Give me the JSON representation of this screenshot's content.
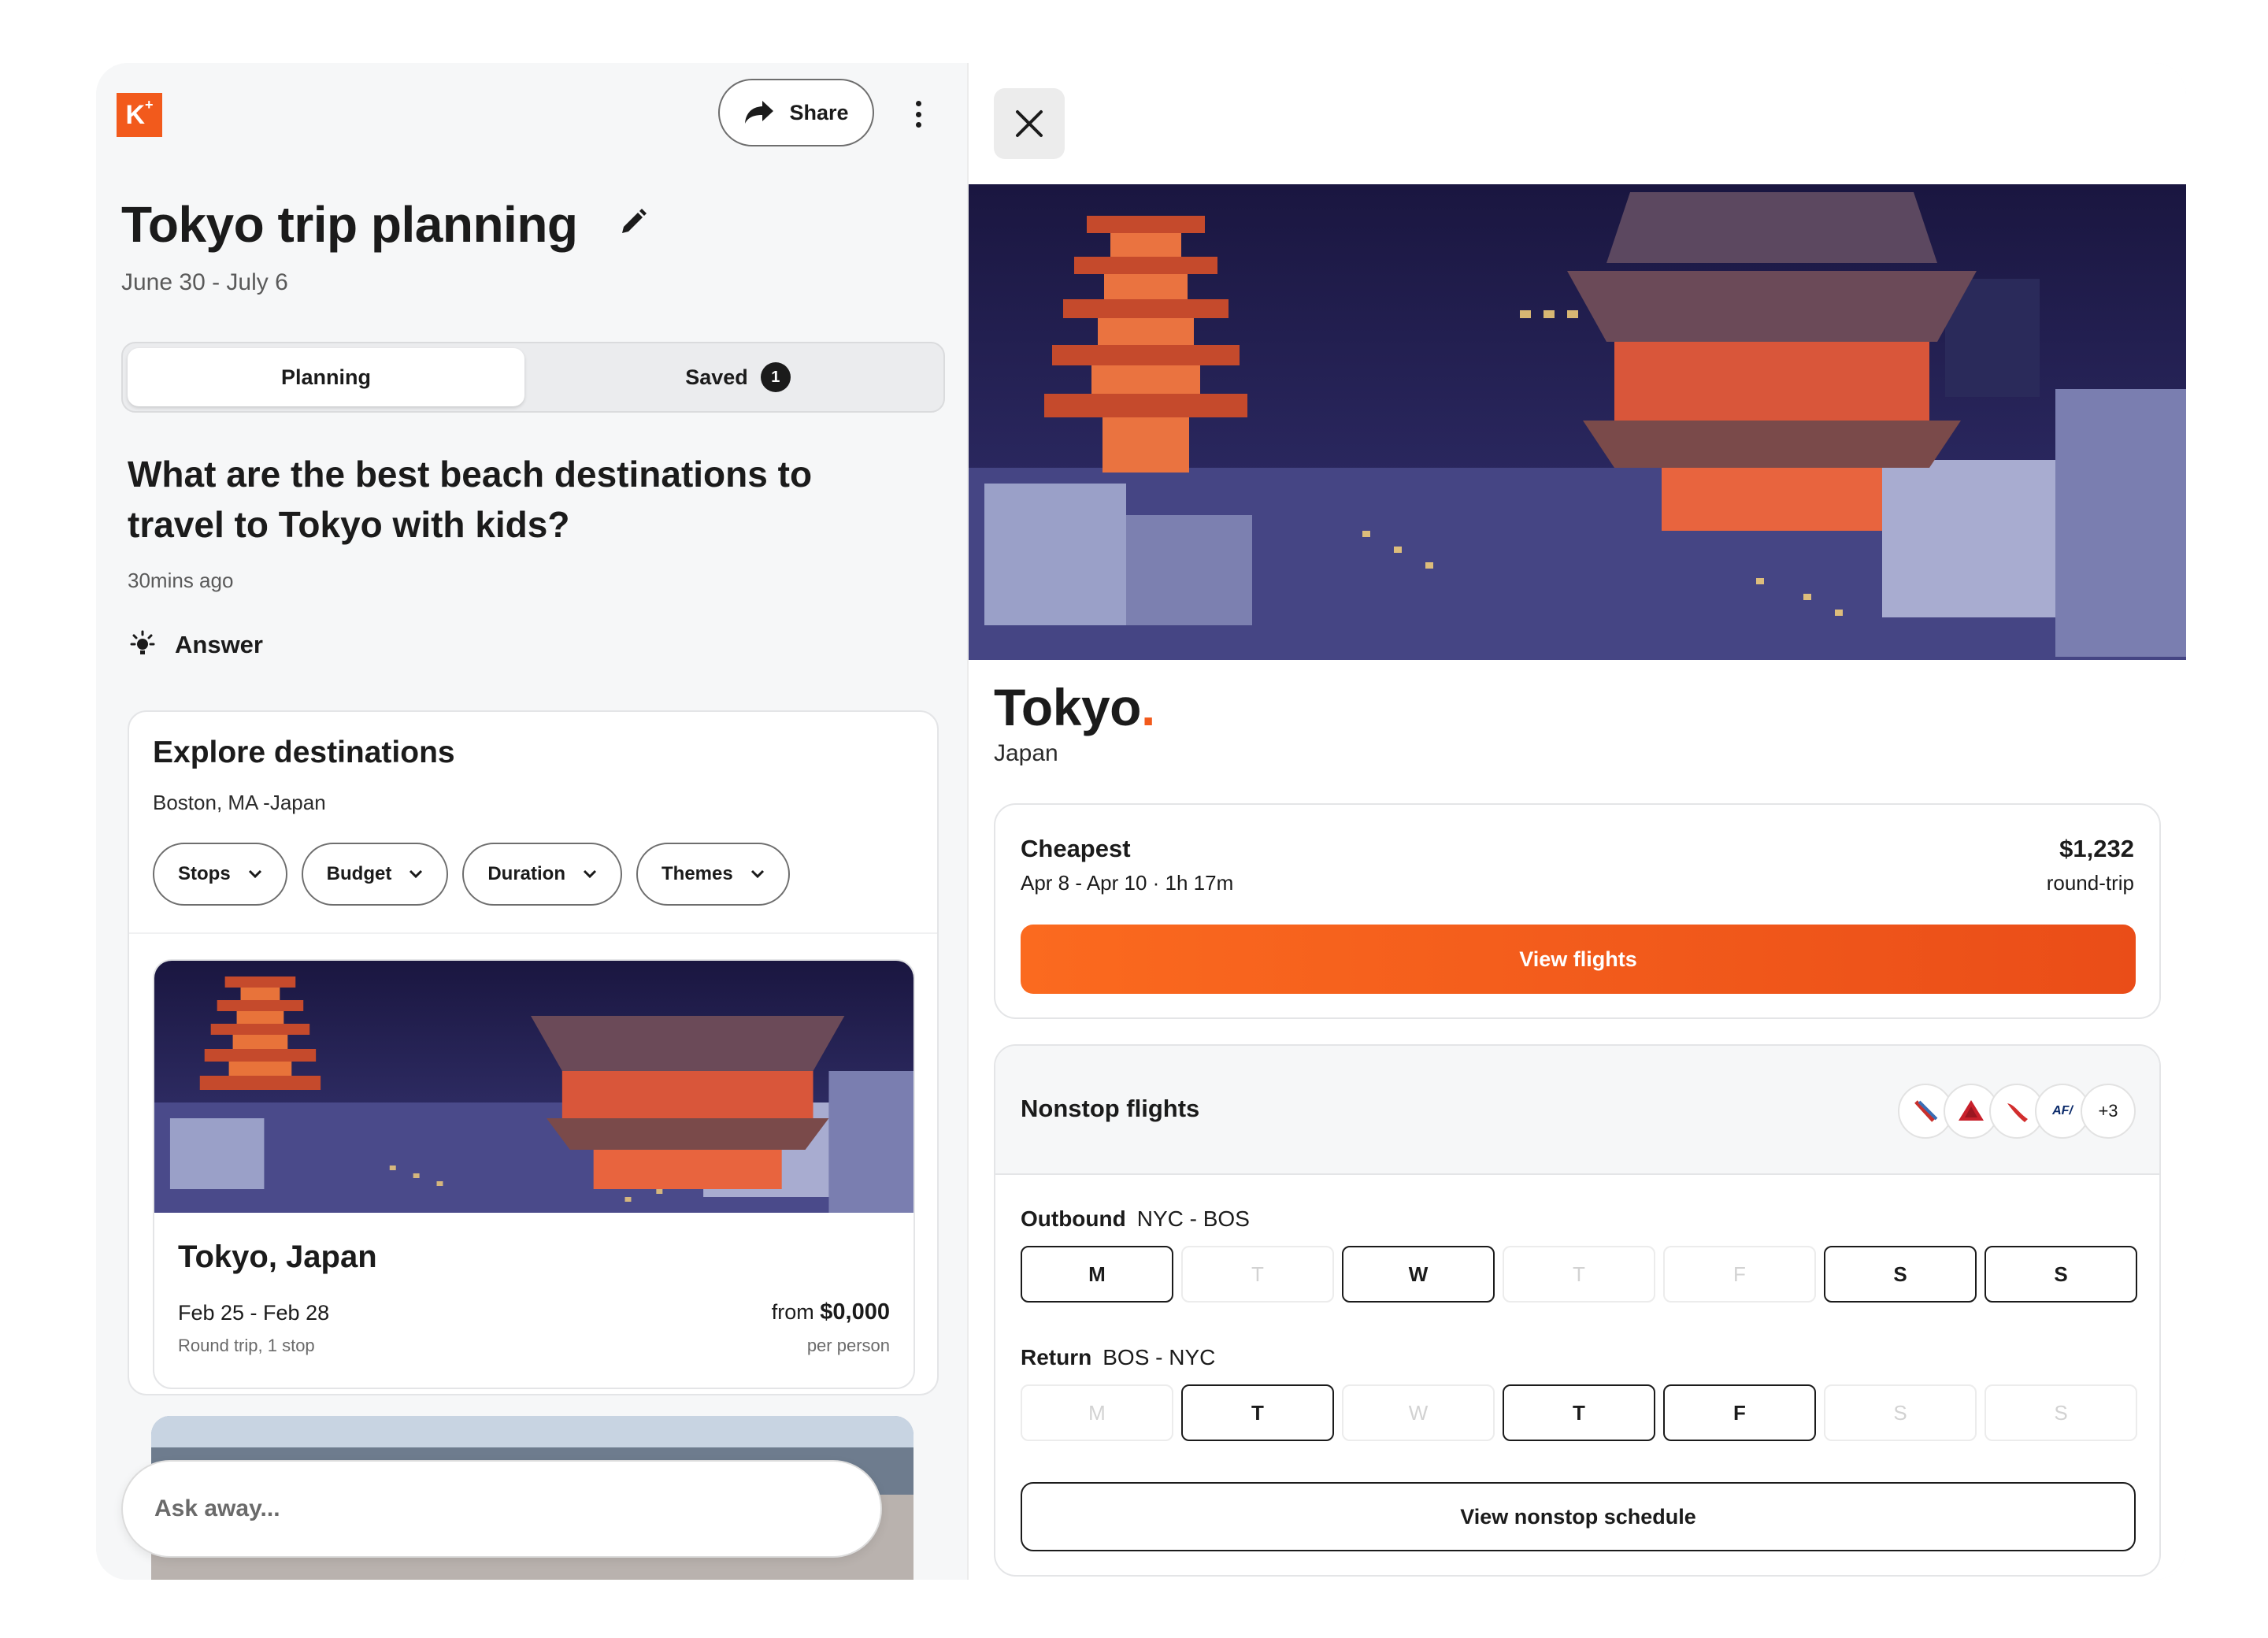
{
  "app": {
    "logo_text": "K",
    "logo_mark": "+"
  },
  "header": {
    "share_label": "Share"
  },
  "trip": {
    "title": "Tokyo trip planning",
    "dates": "June 30 - July 6"
  },
  "tabs": [
    {
      "label": "Planning",
      "active": true
    },
    {
      "label": "Saved",
      "badge": "1",
      "active": false
    }
  ],
  "conversation": {
    "question": "What are the best beach destinations to travel to Tokyo with kids?",
    "time": "30mins ago",
    "answer_label": "Answer"
  },
  "explore": {
    "title": "Explore destinations",
    "route": "Boston, MA -Japan",
    "filters": [
      "Stops",
      "Budget",
      "Duration",
      "Themes"
    ],
    "results": [
      {
        "name": "Tokyo, Japan",
        "dates": "Feb 25 - Feb 28",
        "trip": "Round trip, 1 stop",
        "price_prefix": "from",
        "price": "$0,000",
        "price_note": "per person"
      }
    ]
  },
  "composer": {
    "placeholder": "Ask away..."
  },
  "detail": {
    "city": "Tokyo",
    "city_dot": ".",
    "country": "Japan",
    "cheapest": {
      "label": "Cheapest",
      "dates": "Apr 8 - Apr 10 · 1h 17m",
      "price": "$1,232",
      "trip_type": "round-trip",
      "cta": "View flights"
    },
    "nonstop": {
      "title": "Nonstop flights",
      "airline_icons": [
        "american-airlines-icon",
        "delta-icon",
        "alaska-icon",
        "air-france-icon"
      ],
      "air_france_text": "AF/",
      "more_count": "+3",
      "outbound": {
        "label": "Outbound",
        "route": "NYC - BOS",
        "days": [
          {
            "d": "M",
            "on": true
          },
          {
            "d": "T",
            "on": false
          },
          {
            "d": "W",
            "on": true
          },
          {
            "d": "T",
            "on": false
          },
          {
            "d": "F",
            "on": false
          },
          {
            "d": "S",
            "on": true
          },
          {
            "d": "S",
            "on": true
          }
        ]
      },
      "return": {
        "label": "Return",
        "route": "BOS - NYC",
        "days": [
          {
            "d": "M",
            "on": false
          },
          {
            "d": "T",
            "on": true
          },
          {
            "d": "W",
            "on": false
          },
          {
            "d": "T",
            "on": true
          },
          {
            "d": "F",
            "on": true
          },
          {
            "d": "S",
            "on": false
          },
          {
            "d": "S",
            "on": false
          }
        ]
      },
      "cta": "View nonstop schedule"
    }
  },
  "colors": {
    "brand_orange": "#f25a1c",
    "text_dark": "#1b1b1b"
  }
}
